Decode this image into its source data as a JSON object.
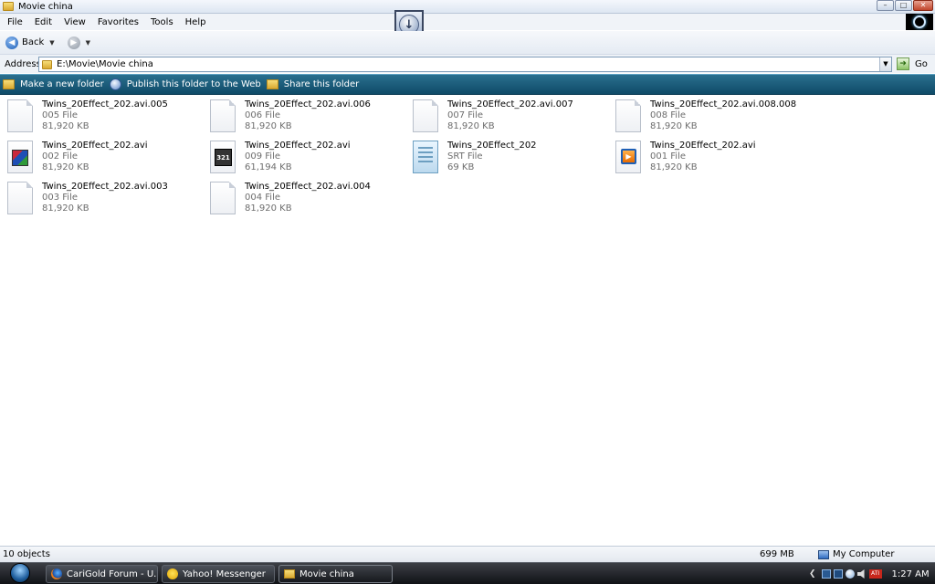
{
  "window": {
    "title": "Movie china",
    "controls": [
      "minimize",
      "maximize",
      "close"
    ]
  },
  "menu": [
    "File",
    "Edit",
    "View",
    "Favorites",
    "Tools",
    "Help"
  ],
  "toolbar": {
    "back_label": "Back"
  },
  "address": {
    "label": "Address",
    "value": "E:\\Movie\\Movie china",
    "go_label": "Go"
  },
  "tasks": {
    "new_folder": "Make a new folder",
    "publish": "Publish this folder to the Web",
    "share": "Share this folder"
  },
  "files": [
    {
      "name": "Twins_20Effect_202.avi.005",
      "type": "005 File",
      "size": "81,920 KB",
      "icon": "generic-file-icon"
    },
    {
      "name": "Twins_20Effect_202.avi.006",
      "type": "006 File",
      "size": "81,920 KB",
      "icon": "generic-file-icon"
    },
    {
      "name": "Twins_20Effect_202.avi.007",
      "type": "007 File",
      "size": "81,920 KB",
      "icon": "generic-file-icon"
    },
    {
      "name": "Twins_20Effect_202.avi.008.008",
      "type": "008 File",
      "size": "81,920 KB",
      "icon": "generic-file-icon"
    },
    {
      "name": "Twins_20Effect_202.avi",
      "type": "002 File",
      "size": "81,920 KB",
      "icon": "winrar-icon"
    },
    {
      "name": "Twins_20Effect_202.avi",
      "type": "009 File",
      "size": "61,194 KB",
      "icon": "clapperboard-icon"
    },
    {
      "name": "Twins_20Effect_202",
      "type": "SRT File",
      "size": "69 KB",
      "icon": "notepad-icon"
    },
    {
      "name": "Twins_20Effect_202.avi",
      "type": "001 File",
      "size": "81,920 KB",
      "icon": "media-player-icon"
    },
    {
      "name": "Twins_20Effect_202.avi.003",
      "type": "003 File",
      "size": "81,920 KB",
      "icon": "generic-file-icon"
    },
    {
      "name": "Twins_20Effect_202.avi.004",
      "type": "004 File",
      "size": "81,920 KB",
      "icon": "generic-file-icon"
    }
  ],
  "status": {
    "count": "10 objects",
    "size": "699 MB",
    "zone": "My Computer"
  },
  "taskbar": {
    "buttons": [
      "CariGold Forum - U...",
      "Yahoo! Messenger",
      "Movie china"
    ],
    "tray_lang": "ATI",
    "clock": "1:27 AM"
  },
  "colors": {
    "tasks_strip": "#1a5a78",
    "taskbar": "#1b1d21"
  }
}
